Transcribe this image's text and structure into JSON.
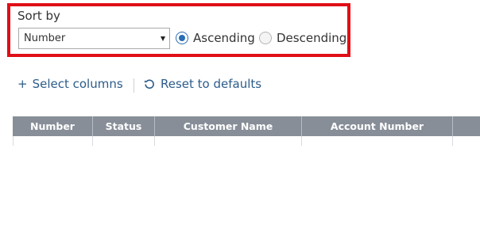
{
  "sort": {
    "title": "Sort by",
    "selected_field": "Number",
    "order": "ascending",
    "ascending_label": "Ascending",
    "descending_label": "Descending"
  },
  "toolbar": {
    "select_columns_label": "Select columns",
    "reset_label": "Reset to defaults"
  },
  "grid": {
    "columns": [
      "Number",
      "Status",
      "Customer Name",
      "Account Number",
      ""
    ]
  },
  "colors": {
    "highlight": "#e00f16",
    "link": "#2c5c8a",
    "radio_accent": "#2a6db5",
    "header_bg": "#878e98"
  },
  "icons": {
    "plus": "plus-icon",
    "reset": "reset-icon",
    "dropdown": "chevron-down-icon"
  }
}
